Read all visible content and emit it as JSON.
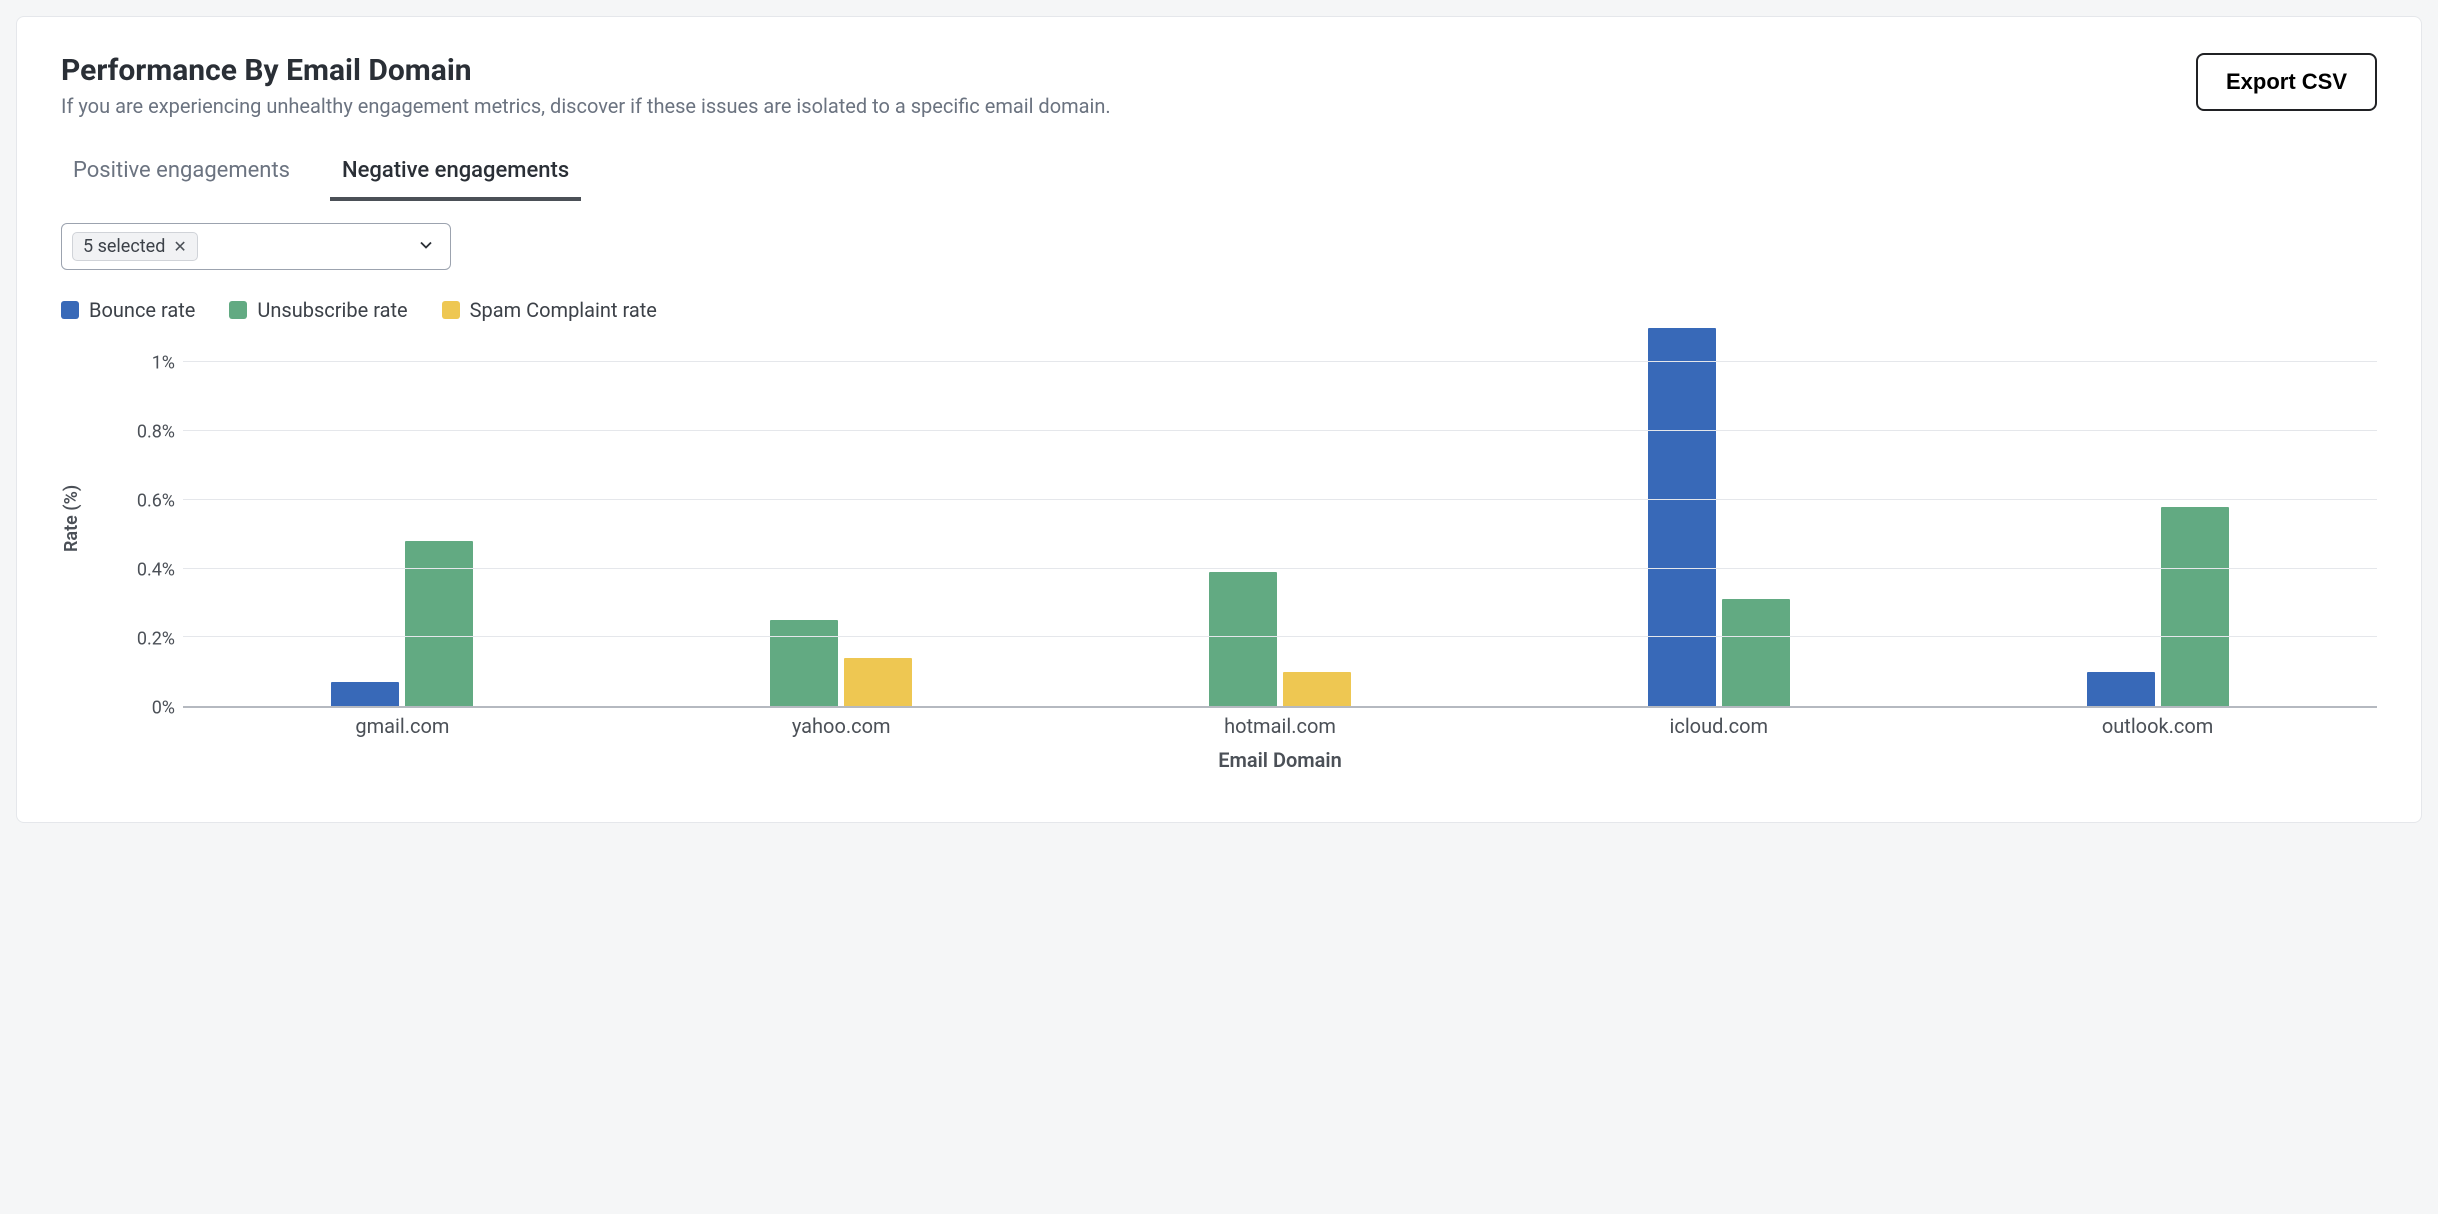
{
  "header": {
    "title": "Performance By Email Domain",
    "subtitle": "If you are experiencing unhealthy engagement metrics, discover if these issues are isolated to a specific email domain.",
    "export_label": "Export CSV"
  },
  "tabs": {
    "positive": "Positive engagements",
    "negative": "Negative engagements",
    "active": "negative"
  },
  "filter": {
    "chip_label": "5 selected"
  },
  "legend": {
    "bounce": "Bounce rate",
    "unsub": "Unsubscribe rate",
    "spam": "Spam Complaint rate"
  },
  "colors": {
    "bounce": "#3869b8",
    "unsub": "#62aa82",
    "spam": "#eec752",
    "grid": "#e5e7eb",
    "axis": "#b5b9c0"
  },
  "chart_data": {
    "type": "bar",
    "title": "",
    "xlabel": "Email Domain",
    "ylabel": "Rate (%)",
    "ylim": [
      0,
      1.1
    ],
    "y_ticks": [
      0,
      0.2,
      0.4,
      0.6,
      0.8,
      1.0
    ],
    "y_tick_labels": [
      "0%",
      "0.2%",
      "0.4%",
      "0.6%",
      "0.8%",
      "1%"
    ],
    "categories": [
      "gmail.com",
      "yahoo.com",
      "hotmail.com",
      "icloud.com",
      "outlook.com"
    ],
    "series": [
      {
        "name": "Bounce rate",
        "color_key": "bounce",
        "values": [
          0.07,
          0.0,
          0.0,
          1.1,
          0.1
        ]
      },
      {
        "name": "Unsubscribe rate",
        "color_key": "unsub",
        "values": [
          0.48,
          0.25,
          0.39,
          0.31,
          0.58
        ]
      },
      {
        "name": "Spam Complaint rate",
        "color_key": "spam",
        "values": [
          0.0,
          0.14,
          0.1,
          0.0,
          0.0
        ]
      }
    ]
  }
}
